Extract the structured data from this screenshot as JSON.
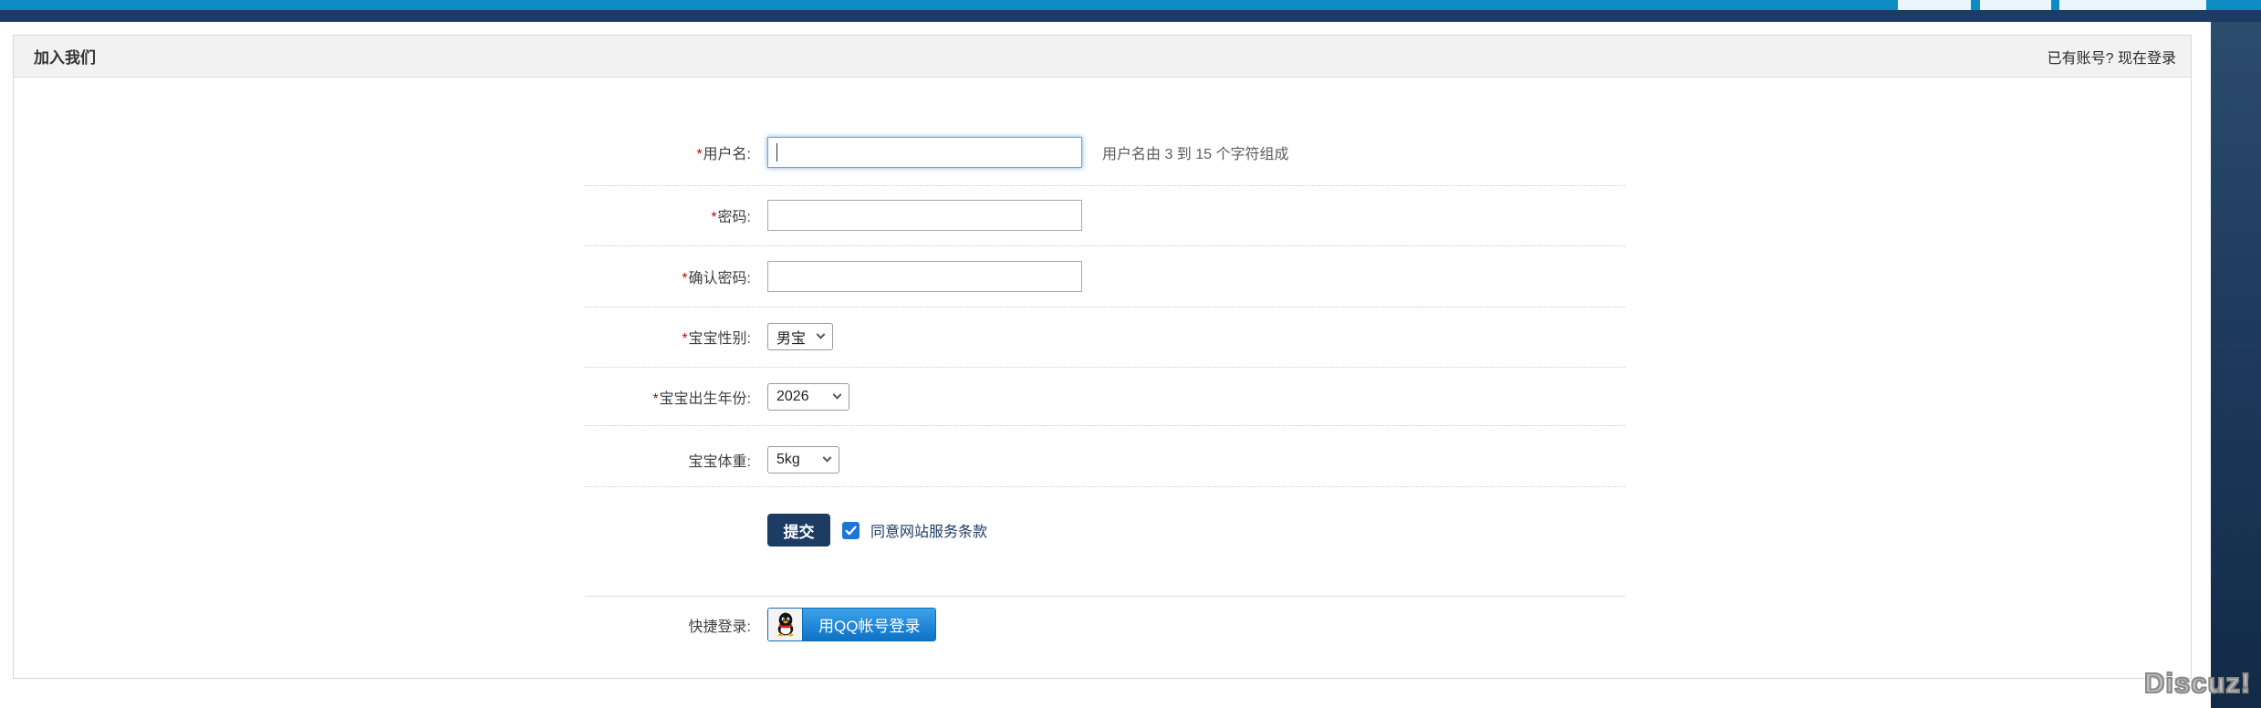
{
  "header": {
    "title": "加入我们",
    "have_account": "已有账号? ",
    "login_now": "现在登录"
  },
  "form": {
    "rows": [
      {
        "mark": "*",
        "label": "用户名:",
        "type": "text",
        "value": "",
        "comment": "用户名由 3 到 15 个字符组成"
      },
      {
        "mark": "*",
        "label": "密码:",
        "type": "password",
        "value": ""
      },
      {
        "mark": "*",
        "label": "确认密码:",
        "type": "password",
        "value": ""
      },
      {
        "mark": "*",
        "label": "宝宝性别:",
        "type": "select",
        "value": "男宝"
      },
      {
        "mark": "*",
        "label": "宝宝出生年份:",
        "type": "select",
        "value": "2026"
      },
      {
        "mark": "",
        "label": "宝宝体重:",
        "type": "select",
        "value": "5kg"
      }
    ],
    "submit_label": "提交",
    "agree_label": "同意网站服务条款",
    "agree_checked": true,
    "quick_login_label": "快捷登录:",
    "qq_button_label": "用QQ帐号登录"
  },
  "footer": {
    "logo": "Discuz!"
  },
  "colors": {
    "topbar_blue": "#0d8cc3",
    "navy": "#1d3c64",
    "header_gray": "#f2f2f2",
    "checkbox_blue": "#1b76d9",
    "qq_blue": "#0e72c6",
    "required_red": "#cc0000",
    "separator": "#cccccc"
  },
  "icons": {
    "chevron": "chevron-down-icon",
    "check": "checkmark-icon",
    "qq": "qq-penguin-icon"
  }
}
